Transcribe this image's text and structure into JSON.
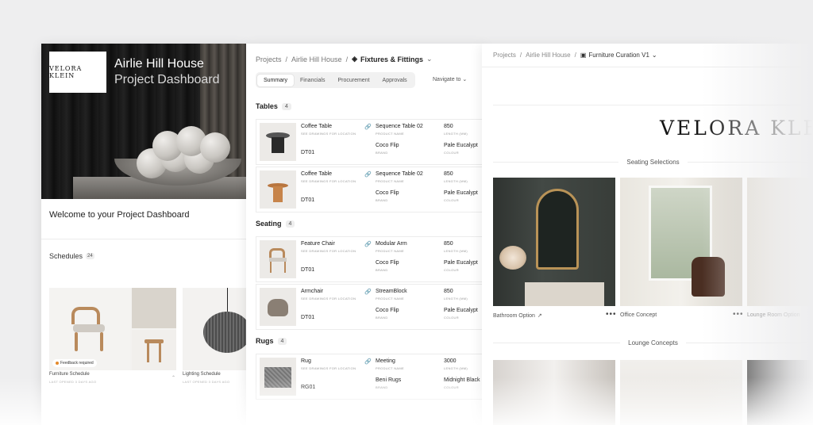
{
  "dashboard": {
    "logo": "VELORA KLEIN",
    "title": "Airlie Hill House",
    "subtitle": "Project Dashboard",
    "welcome": "Welcome to your Project Dashboard",
    "schedules_label": "Schedules",
    "schedules_count": "24",
    "feedback_badge": "Feedback required",
    "cards": [
      {
        "label": "Furniture Schedule",
        "sub": "LAST OPENED 3 DAYS AGO"
      },
      {
        "label": "Lighting Schedule",
        "sub": "LAST OPENED 3 DAYS AGO"
      }
    ]
  },
  "fixtures": {
    "breadcrumb": [
      "Projects",
      "Airlie Hill House",
      "Fixtures & Fittings"
    ],
    "tabs": [
      "Summary",
      "Financials",
      "Procurement",
      "Approvals"
    ],
    "active_tab": "Summary",
    "navigate_to": "Navigate to",
    "sections": [
      {
        "title": "Tables",
        "count": "4",
        "rows": [
          {
            "name": "Coffee Table",
            "sub": "SEE DRAWINGS FOR LOCATION",
            "code": "DT01",
            "product": "Sequence Table 02",
            "product_label": "PRODUCT NAME",
            "brand": "Coco Flip",
            "brand_label": "BRAND",
            "length": "850",
            "length_label": "LENGTH (MM)",
            "colour": "Pale Eucalypt",
            "colour_label": "COLOUR"
          },
          {
            "name": "Coffee Table",
            "sub": "SEE DRAWINGS FOR LOCATION",
            "code": "DT01",
            "product": "Sequence Table 02",
            "product_label": "PRODUCT NAME",
            "brand": "Coco Flip",
            "brand_label": "BRAND",
            "length": "850",
            "length_label": "LENGTH (MM)",
            "colour": "Pale Eucalypt",
            "colour_label": "COLOUR"
          }
        ]
      },
      {
        "title": "Seating",
        "count": "4",
        "rows": [
          {
            "name": "Feature Chair",
            "sub": "SEE DRAWINGS FOR LOCATION",
            "code": "DT01",
            "product": "Modular Arm",
            "product_label": "PRODUCT NAME",
            "brand": "Coco Flip",
            "brand_label": "BRAND",
            "length": "850",
            "length_label": "LENGTH (MM)",
            "colour": "Pale Eucalypt",
            "colour_label": "COLOUR"
          },
          {
            "name": "Armchair",
            "sub": "SEE DRAWINGS FOR LOCATION",
            "code": "DT01",
            "product": "StreamBlock",
            "product_label": "PRODUCT NAME",
            "brand": "Coco Flip",
            "brand_label": "BRAND",
            "length": "850",
            "length_label": "LENGTH (MM)",
            "colour": "Pale Eucalypt",
            "colour_label": "COLOUR"
          }
        ]
      },
      {
        "title": "Rugs",
        "count": "4",
        "rows": [
          {
            "name": "Rug",
            "sub": "SEE DRAWINGS FOR LOCATION",
            "code": "RG01",
            "product": "Meeting",
            "product_label": "PRODUCT NAME",
            "brand": "Beni Rugs",
            "brand_label": "BRAND",
            "length": "3000",
            "length_label": "LENGTH (MM)",
            "colour": "Midnight Black",
            "colour_label": "COLOUR"
          }
        ]
      }
    ]
  },
  "curation": {
    "breadcrumb": [
      "Projects",
      "Airlie Hill House",
      "Furniture Curation V1"
    ],
    "brand": "VELORA KLEIN",
    "seating_title": "Seating Selections",
    "lounge_title": "Lounge Concepts",
    "images": [
      {
        "label": "Bathroom Option"
      },
      {
        "label": "Office Concept"
      },
      {
        "label": "Lounge Room Option"
      }
    ]
  }
}
